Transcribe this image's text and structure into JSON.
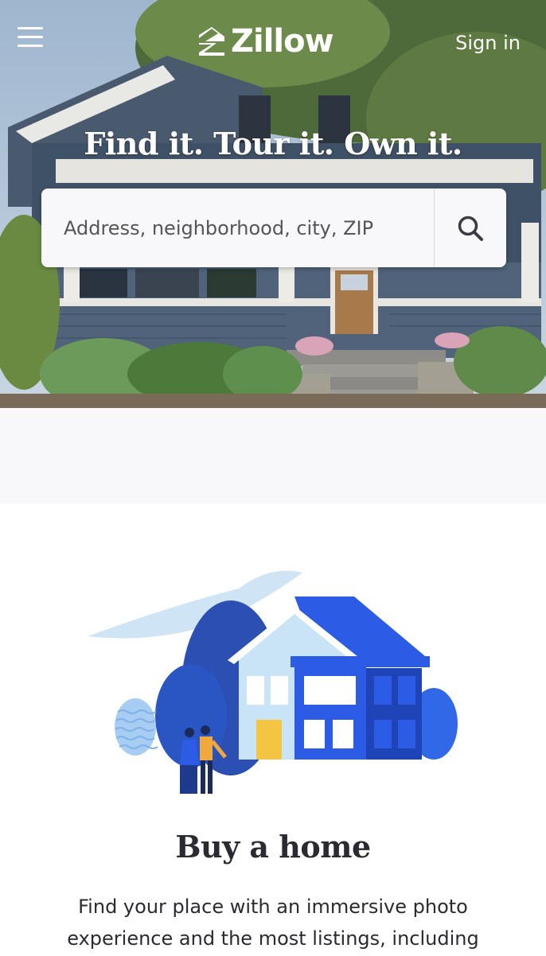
{
  "header": {
    "logo_text": "Zillow",
    "sign_in_label": "Sign in",
    "menu_icon": "hamburger-menu-icon"
  },
  "hero": {
    "title": "Find it. Tour it. Own it.",
    "search": {
      "placeholder": "Address, neighborhood, city, ZIP",
      "value": "",
      "button_icon": "search-icon"
    }
  },
  "buy_section": {
    "illustration": "house-with-couple-illustration",
    "title": "Buy a home",
    "description": "Find your place with an immersive photo experience and the most listings, including"
  },
  "colors": {
    "brand_blue": "#1277e1",
    "illustration_blue": "#2c5ce6",
    "text_dark": "#2a2a33",
    "band_gray": "#f8f8fa"
  }
}
